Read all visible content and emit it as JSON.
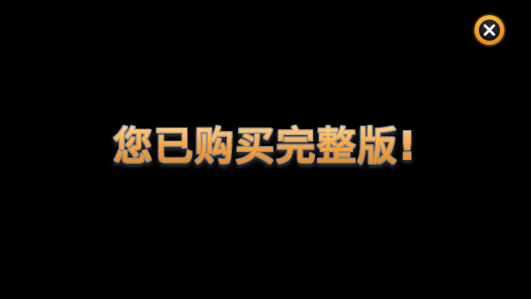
{
  "close_button": {
    "icon": "close-x-icon",
    "accent_color": "#f4a628"
  },
  "message": {
    "text": "您已购买完整版!"
  },
  "colors": {
    "background": "#000000",
    "text_gradient_top": "#ffd9a0",
    "text_gradient_bottom": "#e07a18",
    "text_outline": "#8a8a8a"
  }
}
